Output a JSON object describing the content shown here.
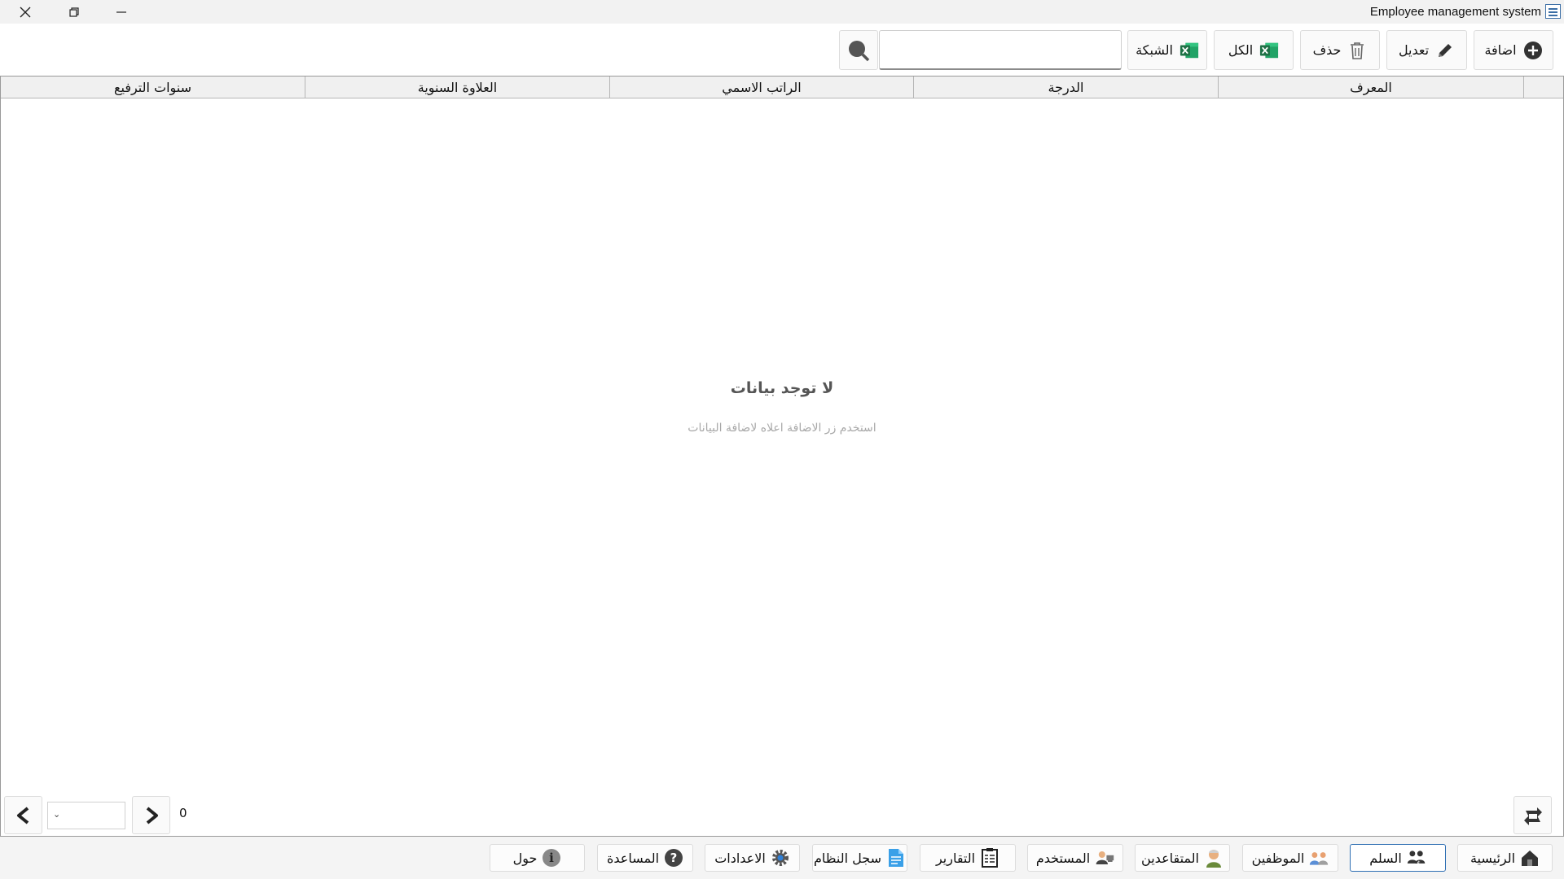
{
  "window": {
    "title": "Employee management system"
  },
  "toolbar": {
    "add_label": "اضافة",
    "edit_label": "تعديل",
    "delete_label": "حذف",
    "export_all_label": "الكل",
    "export_grid_label": "الشبكة",
    "search_value": ""
  },
  "grid": {
    "columns": [
      "المعرف",
      "الدرجة",
      "الراتب الاسمي",
      "العلاوة السنوية",
      "سنوات الترفيع"
    ],
    "rows": [],
    "empty_title": "لا توجد بيانات",
    "empty_subtitle": "استخدم زر الاضافة اعلاه لاضافة البيانات"
  },
  "pager": {
    "count": "0",
    "selected_page": ""
  },
  "nav": {
    "items": [
      {
        "label": "الرئيسية",
        "icon": "home-icon"
      },
      {
        "label": "السلم",
        "icon": "users-salary-icon",
        "active": true
      },
      {
        "label": "الموظفين",
        "icon": "employees-icon"
      },
      {
        "label": "المتقاعدين",
        "icon": "retiree-icon"
      },
      {
        "label": "المستخدم",
        "icon": "user-icon"
      },
      {
        "label": "التقارير",
        "icon": "report-icon"
      },
      {
        "label": "سجل النظام",
        "icon": "log-icon"
      },
      {
        "label": "الاعدادات",
        "icon": "gear-icon"
      },
      {
        "label": "المساعدة",
        "icon": "help-icon"
      },
      {
        "label": "حول",
        "icon": "info-icon"
      }
    ]
  },
  "colors": {
    "accent": "#2f6fb3",
    "excel_green": "#1e7145"
  }
}
